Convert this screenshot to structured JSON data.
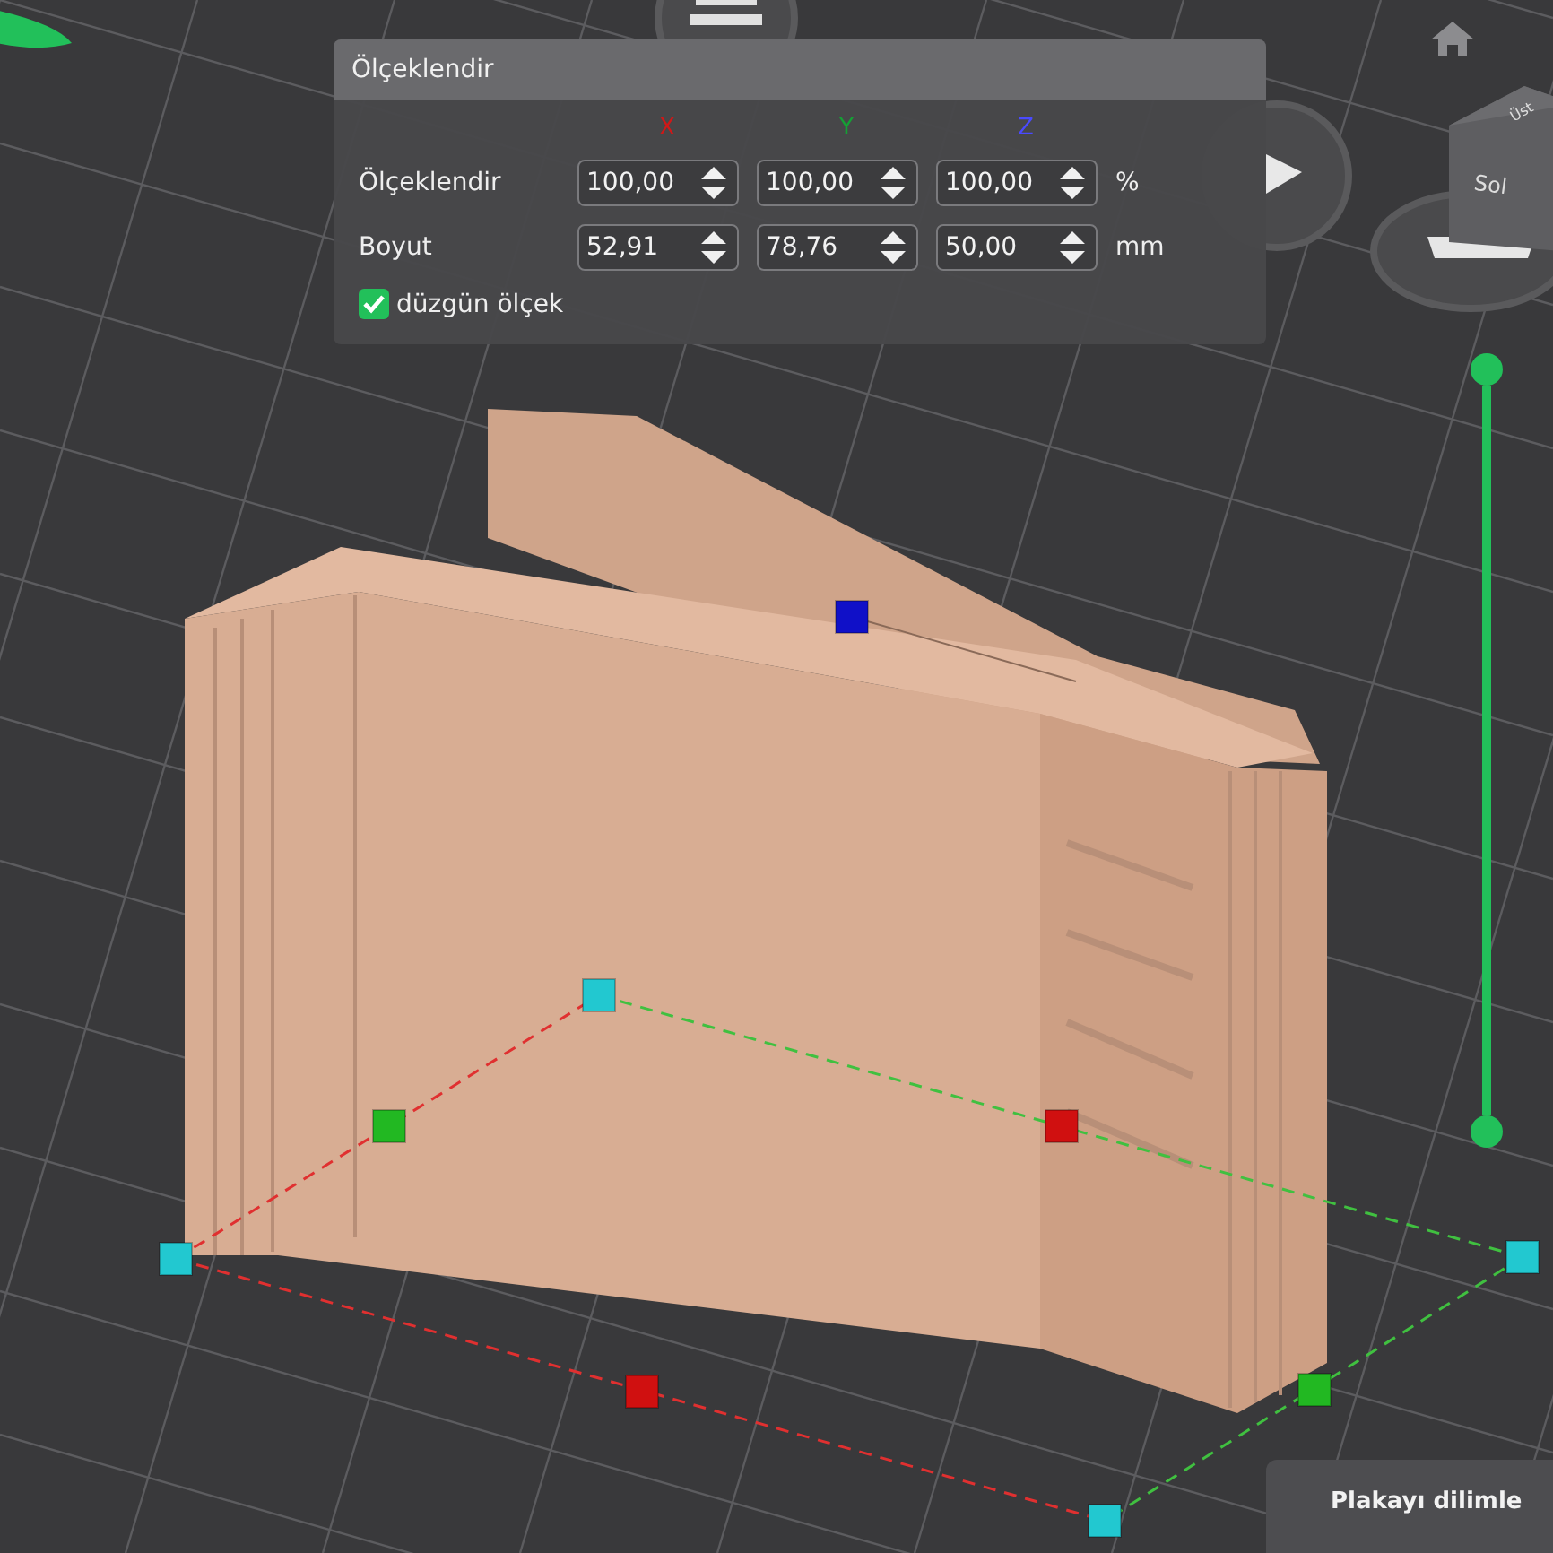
{
  "panel": {
    "title": "Ölçeklendir",
    "axes": [
      {
        "label": "X",
        "color": "#d01818"
      },
      {
        "label": "Y",
        "color": "#15a035"
      },
      {
        "label": "Z",
        "color": "#4a4aff"
      }
    ],
    "rows": [
      {
        "label": "Ölçeklendir",
        "values": [
          "100,00",
          "100,00",
          "100,00"
        ],
        "unit": "%"
      },
      {
        "label": "Boyut",
        "values": [
          "52,91",
          "78,76",
          "50,00"
        ],
        "unit": "mm"
      }
    ],
    "uniform_scale": {
      "label": "düzgün ölçek",
      "checked": true
    }
  },
  "view_cube": {
    "front": "Sol",
    "top": "Üst"
  },
  "layer_slider": {
    "level": 1
  },
  "slice_button": {
    "label": "Plakayı dilimle"
  }
}
